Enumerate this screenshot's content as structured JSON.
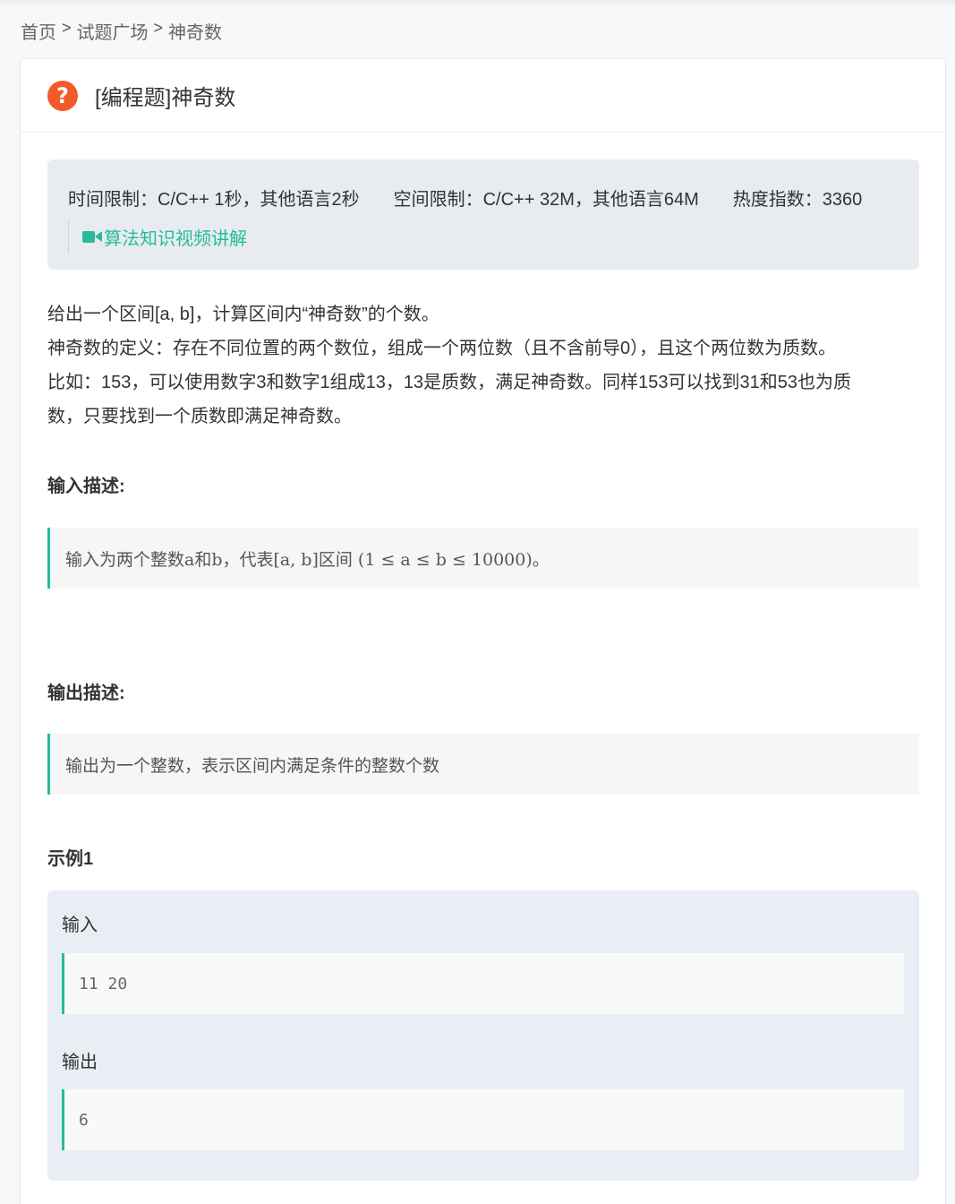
{
  "breadcrumb": {
    "home": "首页",
    "sep": ">",
    "square": "试题广场",
    "current": "神奇数"
  },
  "problem": {
    "title": "[编程题]神奇数",
    "icon": "question-icon",
    "time_limit": "时间限制：C/C++ 1秒，其他语言2秒",
    "space_limit": "空间限制：C/C++ 32M，其他语言64M",
    "heat": "热度指数：3360",
    "video_link": "算法知识视频讲解",
    "description": [
      "给出一个区间[a, b]，计算区间内“神奇数”的个数。",
      "神奇数的定义：存在不同位置的两个数位，组成一个两位数（且不含前导0），且这个两位数为质数。",
      "比如：153，可以使用数字3和数字1组成13，13是质数，满足神奇数。同样153可以找到31和53也为质",
      "数，只要找到一个质数即满足神奇数。"
    ],
    "input_title": "输入描述:",
    "input_desc": "输入为两个整数a和b，代表[a, b]区间 (1 ≤ a ≤ b ≤ 10000)。",
    "output_title": "输出描述:",
    "output_desc": "输出为一个整数，表示区间内满足条件的整数个数",
    "example_title": "示例1",
    "example": {
      "input_label": "输入",
      "input_value": "11 20",
      "output_label": "输出",
      "output_value": "6"
    }
  },
  "colors": {
    "accent": "#25bb9b",
    "icon": "#f35a2b"
  }
}
